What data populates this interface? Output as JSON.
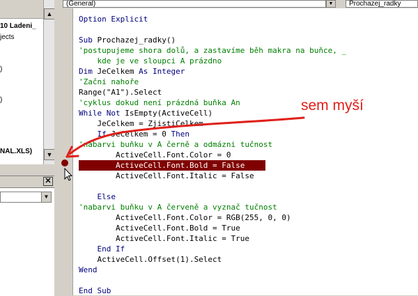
{
  "project_explorer": {
    "items": [
      "10 Ladeni_",
      "jects",
      ")",
      "",
      ")",
      "",
      "",
      "NAL.XLS)"
    ]
  },
  "code_window": {
    "object_combo": "(General)",
    "procedure_combo": "Prochazej_radky",
    "lines": [
      [
        {
          "c": "kw",
          "t": "Option Explicit"
        }
      ],
      [],
      [
        {
          "c": "kw",
          "t": "Sub "
        },
        {
          "c": "tx",
          "t": "Prochazej_radky()"
        }
      ],
      [
        {
          "c": "cm",
          "t": "'postupujeme shora dolů, a zastavíme běh makra na buňce, _"
        }
      ],
      [
        {
          "c": "cm",
          "t": "    kde je ve sloupci A prázdno"
        }
      ],
      [
        {
          "c": "kw",
          "t": "Dim "
        },
        {
          "c": "tx",
          "t": "JeCelkem "
        },
        {
          "c": "kw",
          "t": "As Integer"
        }
      ],
      [
        {
          "c": "cm",
          "t": "'Začni nahoře"
        }
      ],
      [
        {
          "c": "tx",
          "t": "Range(\"A1\").Select"
        }
      ],
      [
        {
          "c": "cm",
          "t": "'cyklus dokud není prázdná buňka An"
        }
      ],
      [
        {
          "c": "kw",
          "t": "While Not "
        },
        {
          "c": "tx",
          "t": "IsEmpty(ActiveCell)"
        }
      ],
      [
        {
          "c": "tx",
          "t": "    JeCelkem = ZjistiCelkem"
        }
      ],
      [
        {
          "c": "kw",
          "t": "    If "
        },
        {
          "c": "tx",
          "t": "JeCelkem = 0 "
        },
        {
          "c": "kw",
          "t": "Then"
        }
      ],
      [
        {
          "c": "cm",
          "t": "'nabarvi buňku v A černě a odmázni tučnost"
        }
      ],
      [
        {
          "c": "tx",
          "t": "        ActiveCell.Font.Color = 0"
        }
      ],
      [
        {
          "c": "tx",
          "t": "        ActiveCell.Font.Bold = False"
        }
      ],
      [
        {
          "c": "tx",
          "t": "        ActiveCell.Font.Italic = False"
        }
      ],
      [],
      [
        {
          "c": "kw",
          "t": "    Else"
        }
      ],
      [
        {
          "c": "cm",
          "t": "'nabarvi buňku v A červeně a vyznač tučnost"
        }
      ],
      [
        {
          "c": "tx",
          "t": "        ActiveCell.Font.Color = RGB(255, 0, 0)"
        }
      ],
      [
        {
          "c": "tx",
          "t": "        ActiveCell.Font.Bold = True"
        }
      ],
      [
        {
          "c": "tx",
          "t": "        ActiveCell.Font.Italic = True"
        }
      ],
      [
        {
          "c": "kw",
          "t": "    End If"
        }
      ],
      [
        {
          "c": "tx",
          "t": "    ActiveCell.Offset(1).Select"
        }
      ],
      [
        {
          "c": "kw",
          "t": "Wend"
        }
      ],
      [],
      [
        {
          "c": "kw",
          "t": "End Sub"
        }
      ]
    ],
    "highlighted_line": 14
  },
  "annotation": {
    "text": "sem myší",
    "color": "#e0201a"
  },
  "colors": {
    "keyword": "#00007f",
    "comment": "#007f00",
    "breakpoint": "#800000"
  }
}
